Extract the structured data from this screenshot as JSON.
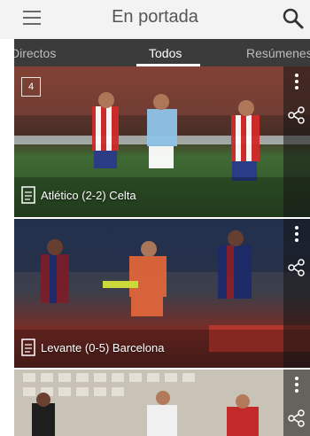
{
  "header": {
    "title": "En portada",
    "menu_icon": "hamburger-menu-icon",
    "search_icon": "search-icon"
  },
  "tabs": [
    {
      "label": "Directos",
      "active": false
    },
    {
      "label": "Todos",
      "active": true
    },
    {
      "label": "Resúmenes",
      "active": false
    }
  ],
  "cards": [
    {
      "caption": "Atlético (2-2) Celta",
      "badge_count": "4"
    },
    {
      "caption": "Levante (0-5) Barcelona",
      "badge_count": ""
    },
    {
      "caption": "",
      "badge_count": ""
    }
  ],
  "colors": {
    "header_bg": "#f3f3f3",
    "tab_bar_bg": "#3b3b3b",
    "active_tab_text": "#ffffff",
    "inactive_tab_text": "#bdbdbd"
  }
}
